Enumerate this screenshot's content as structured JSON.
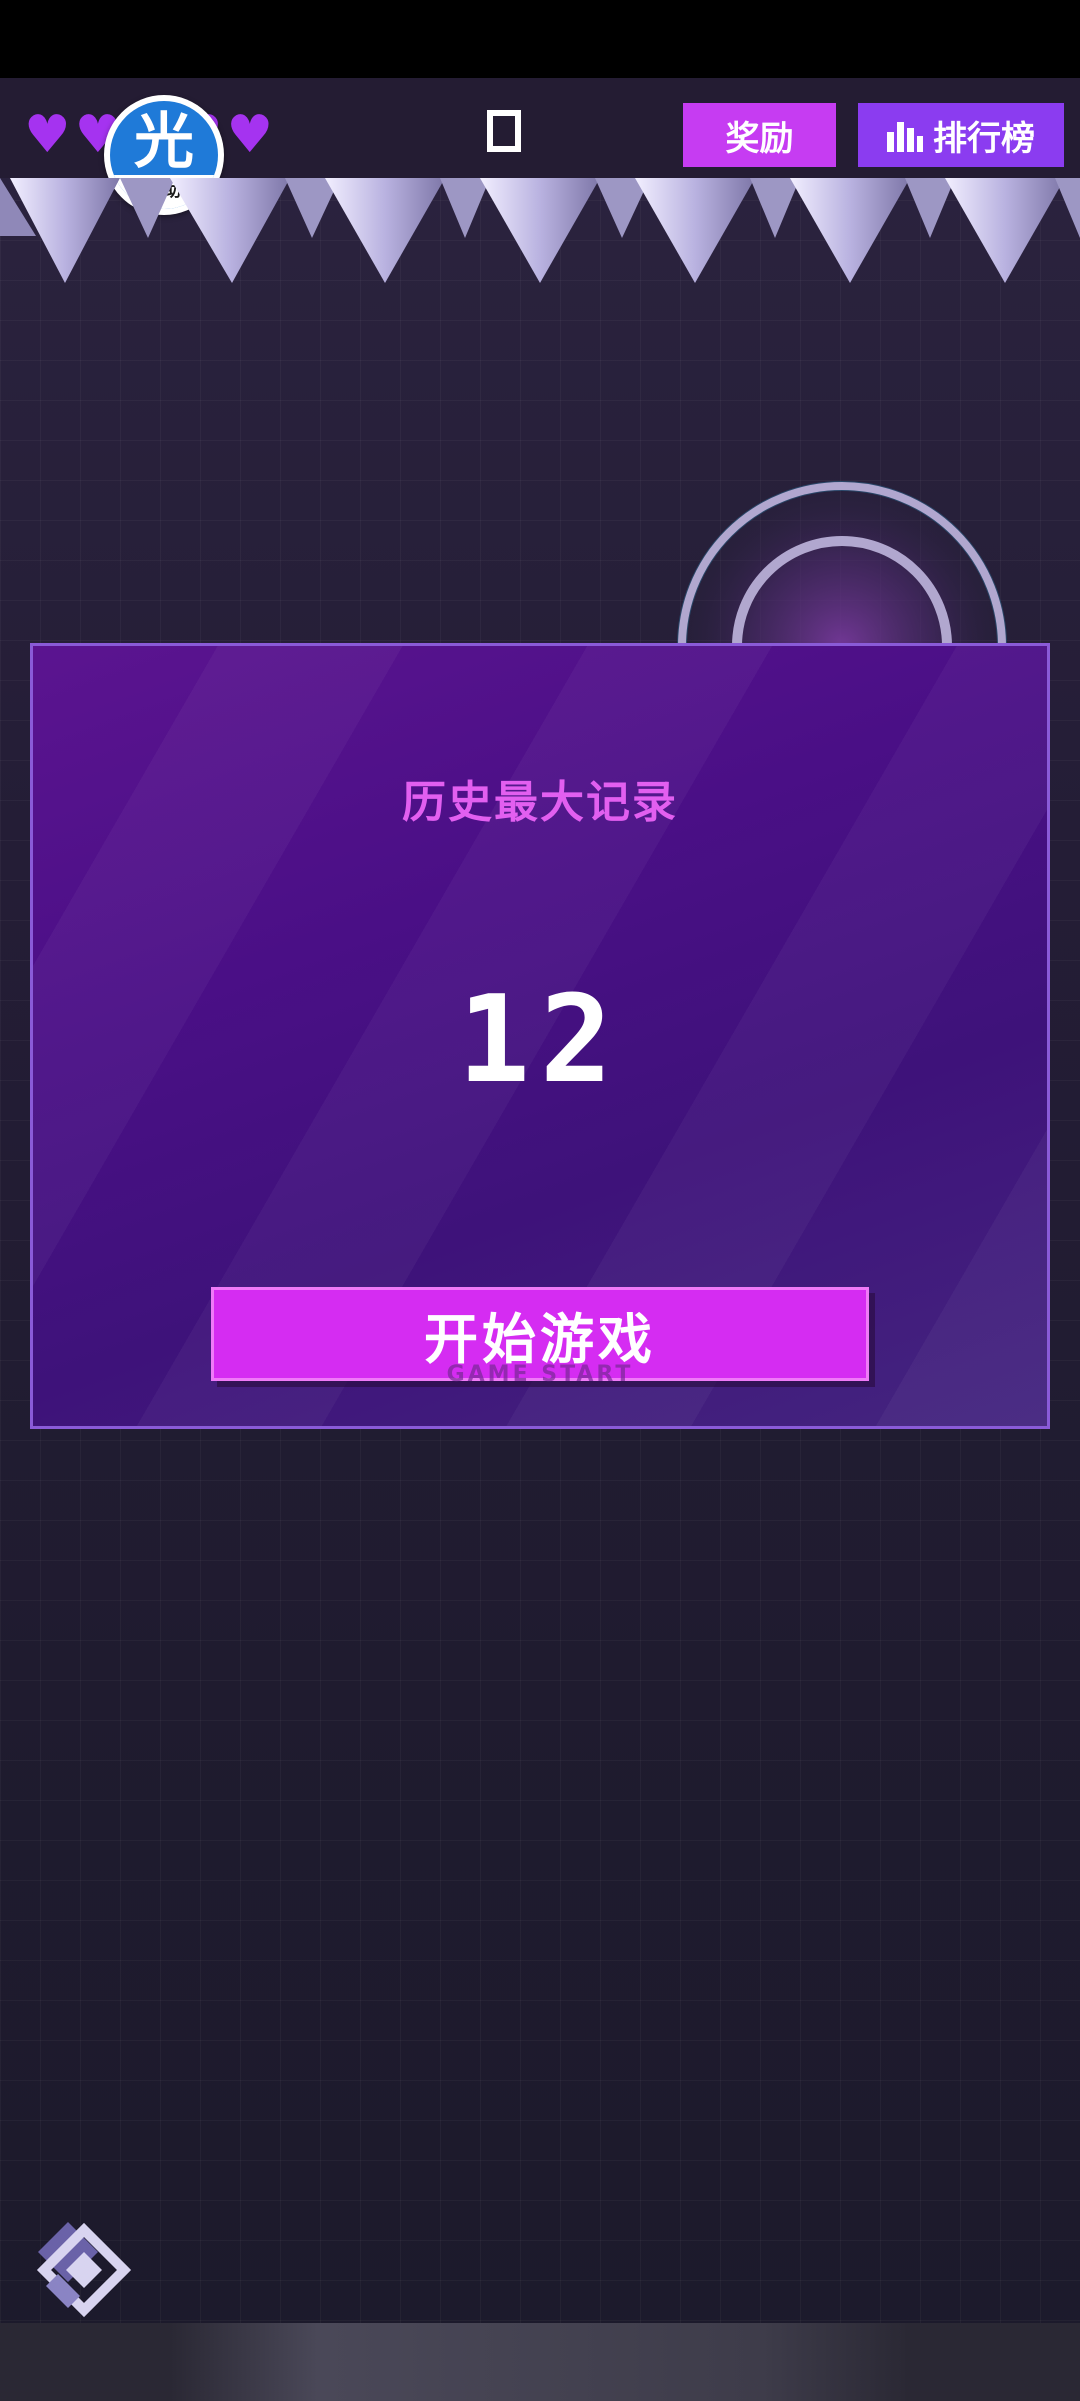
{
  "topbar": {
    "lives": [
      "heart",
      "heart",
      "heart",
      "heart",
      "heart"
    ],
    "helper_badge": {
      "glyph": "光",
      "caption": "光环助手"
    },
    "reward_label": "奖励",
    "rank_label": "排行榜"
  },
  "record_panel": {
    "title": "历史最大记录",
    "value": "12",
    "start_label": "开始游戏",
    "start_sub": "GAME START"
  },
  "colors": {
    "accent_magenta": "#d52cf2",
    "accent_purple": "#8b3cf0",
    "heart": "#a533f0"
  },
  "icons": [
    "heart-icon",
    "pause-icon",
    "bar-chart-icon",
    "game-logo-icon",
    "spike-icon",
    "target-ring-icon"
  ]
}
